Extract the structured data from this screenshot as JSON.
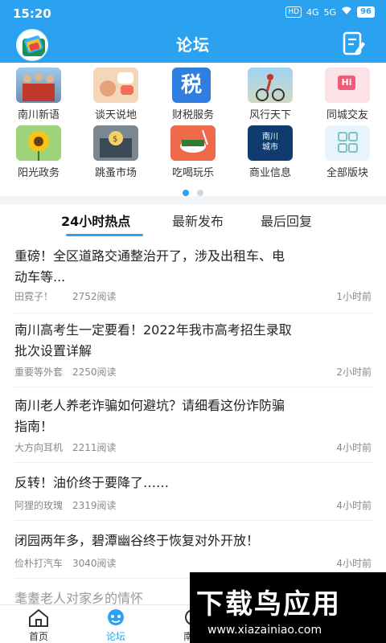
{
  "status": {
    "time": "15:20",
    "network": "4G",
    "network2": "5G",
    "hd": "HD",
    "battery": "96"
  },
  "header": {
    "title": "论坛"
  },
  "categories": [
    {
      "label": "南川新语",
      "icon": "people-photo-icon"
    },
    {
      "label": "谈天说地",
      "icon": "chat-photo-icon"
    },
    {
      "label": "财税服务",
      "icon": "tax-icon",
      "glyph": "税"
    },
    {
      "label": "风行天下",
      "icon": "cycling-photo-icon"
    },
    {
      "label": "同城交友",
      "icon": "hi-photo-icon",
      "glyph": "Hi"
    },
    {
      "label": "阳光政务",
      "icon": "sunflower-icon"
    },
    {
      "label": "跳蚤市场",
      "icon": "market-photo-icon"
    },
    {
      "label": "吃喝玩乐",
      "icon": "food-icon"
    },
    {
      "label": "商业信息",
      "icon": "city-icon",
      "glyph": "南川\n城市"
    },
    {
      "label": "全部版块",
      "icon": "grid-icon"
    }
  ],
  "tabs": [
    {
      "label": "24小时热点"
    },
    {
      "label": "最新发布"
    },
    {
      "label": "最后回复"
    }
  ],
  "posts": [
    {
      "title_line1": "重磅！全区道路交通整治开了，涉及出租车、电",
      "title_line2": "动车等...",
      "author": "田霓子！",
      "reads": "2752阅读",
      "time": "1小时前"
    },
    {
      "title_line1": "南川高考生一定要看！2022年我市高考招生录取",
      "title_line2": "批次设置详解",
      "author": "重要等外套",
      "reads": "2250阅读",
      "time": "2小时前"
    },
    {
      "title_line1": "南川老人养老诈骗如何避坑？请细看这份诈防骗",
      "title_line2": "指南！",
      "author": "大方向耳机",
      "reads": "2211阅读",
      "time": "4小时前"
    },
    {
      "title_line1": "反转！油价终于要降了……",
      "title_line2": "",
      "author": "阿狸的玫瑰",
      "reads": "2319阅读",
      "time": "4小时前"
    },
    {
      "title_line1": "闭园两年多，碧潭幽谷终于恢复对外开放！",
      "title_line2": "",
      "author": "俭朴打汽车",
      "reads": "3040阅读",
      "time": "4小时前"
    },
    {
      "title_line1": "耄耋老人对家乡的情怀",
      "title_line2": "",
      "author": "",
      "reads": "",
      "time": ""
    }
  ],
  "bottom_nav": [
    {
      "label": "首页",
      "icon": "home-icon"
    },
    {
      "label": "论坛",
      "icon": "forum-icon"
    },
    {
      "label": "南川",
      "icon": "city-nav-icon"
    }
  ],
  "watermark": {
    "title": "下载鸟应用",
    "url": "www.xiazainiao.com"
  },
  "colors": {
    "accent": "#2aa2f0",
    "text": "#222222",
    "meta": "#888888"
  }
}
